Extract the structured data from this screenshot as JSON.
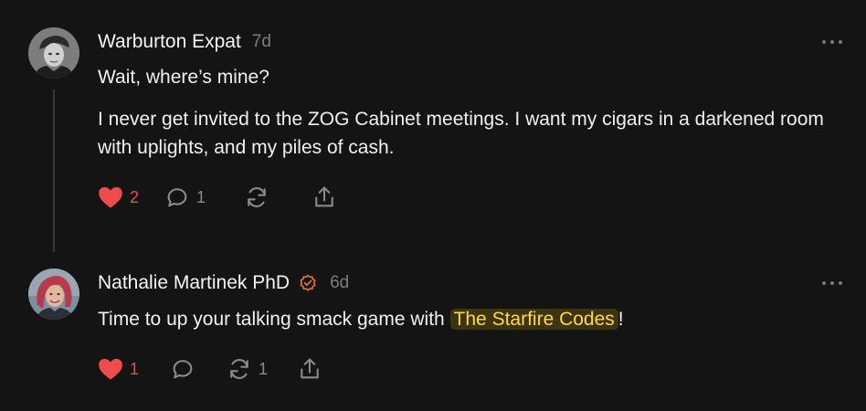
{
  "comments": [
    {
      "author": "Warburton Expat",
      "time": "7d",
      "paragraphs": [
        "Wait, where’s mine?",
        "I never get invited to the ZOG Cabinet meetings. I want my cigars in a darkened room with uplights, and my piles of cash."
      ],
      "likes": "2",
      "replies": "1",
      "restacks": "",
      "icons": {
        "like": "heart-icon",
        "reply": "comment-icon",
        "restack": "restack-icon",
        "share": "share-icon",
        "more": "ellipsis-icon"
      }
    },
    {
      "author": "Nathalie Martinek PhD",
      "verified": true,
      "time": "6d",
      "text_before": "Time to up your talking smack game with ",
      "link_text": "The Starfire Codes",
      "text_after": "!",
      "likes": "1",
      "replies": "",
      "restacks": "1",
      "icons": {
        "like": "heart-icon",
        "reply": "comment-icon",
        "restack": "restack-icon",
        "share": "share-icon",
        "more": "ellipsis-icon",
        "badge": "verified-badge-icon"
      }
    }
  ],
  "colors": {
    "background": "#141414",
    "heart": "#ef4b4b",
    "link_text": "#ffd84d",
    "link_highlight": "#3d3410",
    "badge": "#f0702e",
    "muted": "#7d7d7d"
  }
}
